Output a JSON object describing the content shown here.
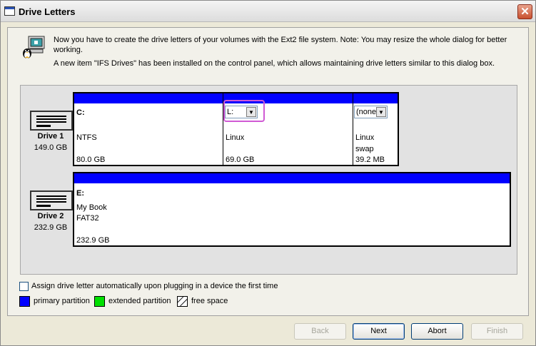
{
  "window": {
    "title": "Drive Letters",
    "close_glyph": "✕"
  },
  "intro": {
    "line1": "Now you have to create the drive letters of your volumes with the Ext2 file system. Note: You may resize the whole dialog for better",
    "line2": "working.",
    "line3": "A new item \"IFS Drives\" has been installed on the control panel, which allows maintaining drive letters similar to this dialog box.",
    "icon": "computer-with-penguin-icon"
  },
  "drives": [
    {
      "name": "Drive 1",
      "size": "149.0 GB",
      "icon": "hard-disk-icon",
      "partitions": [
        {
          "letter": "C:",
          "line1": "NTFS",
          "line2": "",
          "size": "80.0 GB",
          "type": "primary"
        },
        {
          "letter_select": "L:",
          "line1": "Linux",
          "line2": "",
          "size": "69.0 GB",
          "type": "primary"
        },
        {
          "letter_select": "(none)",
          "line1": "Linux",
          "line2": "swap",
          "size": "39.2 MB",
          "type": "primary"
        }
      ]
    },
    {
      "name": "Drive 2",
      "size": "232.9 GB",
      "icon": "hard-disk-icon",
      "partitions": [
        {
          "letter": "E:",
          "line1": "My Book",
          "line2": "FAT32",
          "size": "232.9 GB",
          "type": "primary"
        }
      ]
    }
  ],
  "auto_assign": {
    "label": "Assign drive letter automatically upon plugging in a device the first time",
    "checked": false
  },
  "legend": {
    "primary": {
      "label": "primary partition",
      "color": "#0000ff"
    },
    "extended": {
      "label": "extended partition",
      "color": "#00e000"
    },
    "free": {
      "label": "free space"
    }
  },
  "buttons": {
    "back": "Back",
    "next": "Next",
    "abort": "Abort",
    "finish": "Finish"
  },
  "colors": {
    "primary_partition": "#0000ff",
    "highlight": "#d05ad4"
  }
}
